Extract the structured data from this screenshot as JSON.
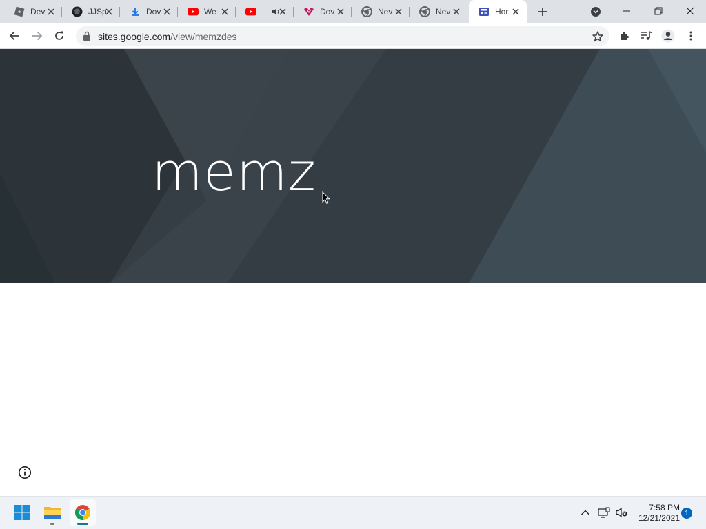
{
  "browser": {
    "tabs": [
      {
        "title": "Dev",
        "icon": "roblox-icon"
      },
      {
        "title": "JJSp",
        "icon": "roblox-game-icon"
      },
      {
        "title": "Dov",
        "icon": "download-icon"
      },
      {
        "title": "We",
        "icon": "youtube-icon"
      },
      {
        "title": "",
        "icon": "youtube-icon",
        "audio": "speaker-icon"
      },
      {
        "title": "Dov",
        "icon": "heart-logo-icon"
      },
      {
        "title": "Nev",
        "icon": "chrome-icon"
      },
      {
        "title": "Nev",
        "icon": "chrome-icon"
      },
      {
        "title": "Hor",
        "icon": "google-sites-icon",
        "active": true
      }
    ],
    "address": {
      "domain": "sites.google.com",
      "path": "/view/memzdes"
    }
  },
  "page": {
    "site_title": "memz"
  },
  "taskbar": {
    "apps": [
      "start-button",
      "file-explorer",
      "chrome"
    ],
    "clock": {
      "time": "7:58 PM",
      "date": "12/21/2021"
    },
    "notification_count": "1"
  },
  "colors": {
    "tabstrip": "#dee1e6",
    "banner": "#333c42",
    "accent": "#0067c0"
  }
}
